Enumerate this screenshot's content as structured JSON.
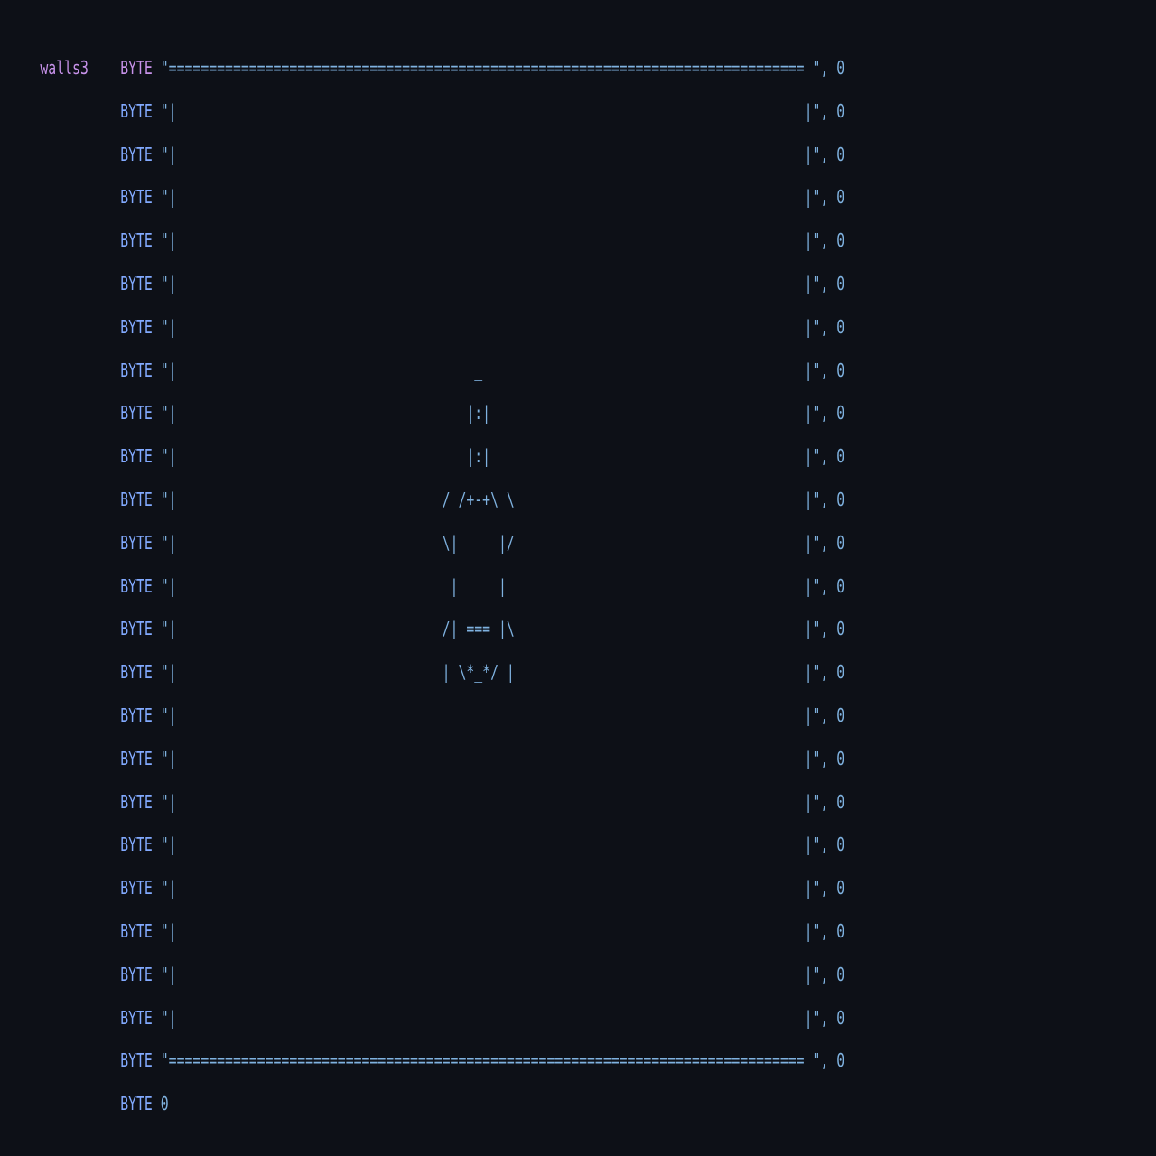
{
  "colors": {
    "background": "#0d1017",
    "keyword_first": "#c792ea",
    "keyword": "#82aaff",
    "string": "#7fb2e0"
  },
  "code": {
    "label": "walls3",
    "lines": [
      {
        "kw": "BYTE",
        "str": "\"=============================================================================== \"",
        "tail": ", 0"
      },
      {
        "kw": "BYTE",
        "str": "\"|                                                                              |\"",
        "tail": ", 0"
      },
      {
        "kw": "BYTE",
        "str": "\"|                                                                              |\"",
        "tail": ", 0"
      },
      {
        "kw": "BYTE",
        "str": "\"|                                                                              |\"",
        "tail": ", 0"
      },
      {
        "kw": "BYTE",
        "str": "\"|                                                                              |\"",
        "tail": ", 0"
      },
      {
        "kw": "BYTE",
        "str": "\"|                                                                              |\"",
        "tail": ", 0"
      },
      {
        "kw": "BYTE",
        "str": "\"|                                                                              |\"",
        "tail": ", 0"
      },
      {
        "kw": "BYTE",
        "str": "\"|                                     _                                        |\"",
        "tail": ", 0"
      },
      {
        "kw": "BYTE",
        "str": "\"|                                    |:|                                       |\"",
        "tail": ", 0"
      },
      {
        "kw": "BYTE",
        "str": "\"|                                    |:|                                       |\"",
        "tail": ", 0"
      },
      {
        "kw": "BYTE",
        "str": "\"|                                 / /+-+\\ \\                                    |\"",
        "tail": ", 0"
      },
      {
        "kw": "BYTE",
        "str": "\"|                                 \\|     |/                                    |\"",
        "tail": ", 0"
      },
      {
        "kw": "BYTE",
        "str": "\"|                                  |     |                                     |\"",
        "tail": ", 0"
      },
      {
        "kw": "BYTE",
        "str": "\"|                                 /| === |\\                                    |\"",
        "tail": ", 0"
      },
      {
        "kw": "BYTE",
        "str": "\"|                                 | \\*_*/ |                                    |\"",
        "tail": ", 0"
      },
      {
        "kw": "BYTE",
        "str": "\"|                                                                              |\"",
        "tail": ", 0"
      },
      {
        "kw": "BYTE",
        "str": "\"|                                                                              |\"",
        "tail": ", 0"
      },
      {
        "kw": "BYTE",
        "str": "\"|                                                                              |\"",
        "tail": ", 0"
      },
      {
        "kw": "BYTE",
        "str": "\"|                                                                              |\"",
        "tail": ", 0"
      },
      {
        "kw": "BYTE",
        "str": "\"|                                                                              |\"",
        "tail": ", 0"
      },
      {
        "kw": "BYTE",
        "str": "\"|                                                                              |\"",
        "tail": ", 0"
      },
      {
        "kw": "BYTE",
        "str": "\"|                                                                              |\"",
        "tail": ", 0"
      },
      {
        "kw": "BYTE",
        "str": "\"|                                                                              |\"",
        "tail": ", 0"
      },
      {
        "kw": "BYTE",
        "str": "\"=============================================================================== \"",
        "tail": ", 0"
      },
      {
        "kw": "BYTE",
        "str": "",
        "tail": "0"
      }
    ]
  }
}
